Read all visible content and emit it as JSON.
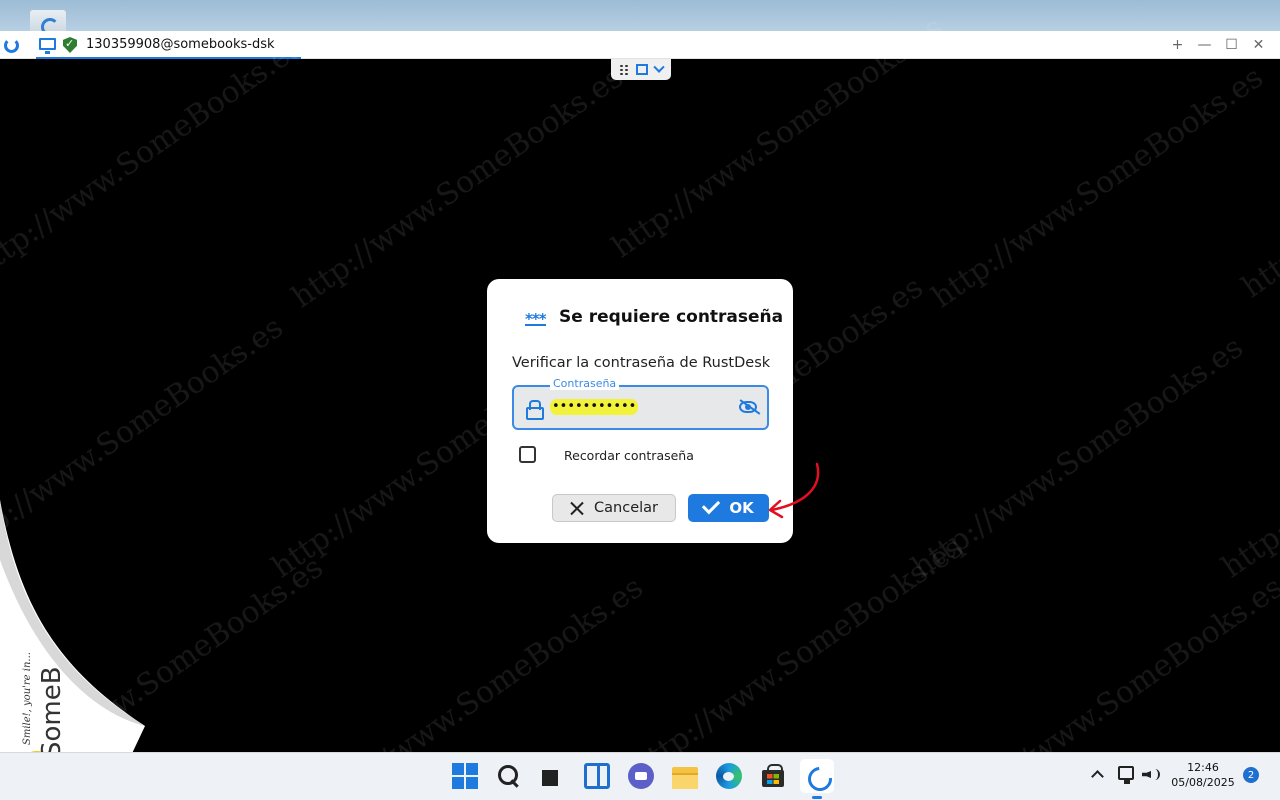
{
  "remote_window": {
    "tab_title": "130359908@somebooks-dsk",
    "controls": {
      "add": "+",
      "minimize": "—",
      "maximize": "☐",
      "close": "✕"
    }
  },
  "watermark": {
    "text": "http://www.SomeBooks.es"
  },
  "dialog": {
    "title": "Se requiere contraseña",
    "title_icon": "***",
    "message": "Verificar la contraseña de RustDesk",
    "password_label": "Contraseña",
    "password_value": "•••••••••••",
    "remember_label": "Recordar contraseña",
    "remember_checked": false,
    "cancel_label": "Cancelar",
    "ok_label": "OK"
  },
  "branding": {
    "slogan": "Smile!, you're in...",
    "brand": "SomeBooks"
  },
  "taskbar": {
    "time": "12:46",
    "date": "05/08/2025",
    "notification_count": "2"
  },
  "colors": {
    "accent": "#1f7ae0",
    "annotation": "#e01020",
    "highlight": "#f2f23a"
  }
}
